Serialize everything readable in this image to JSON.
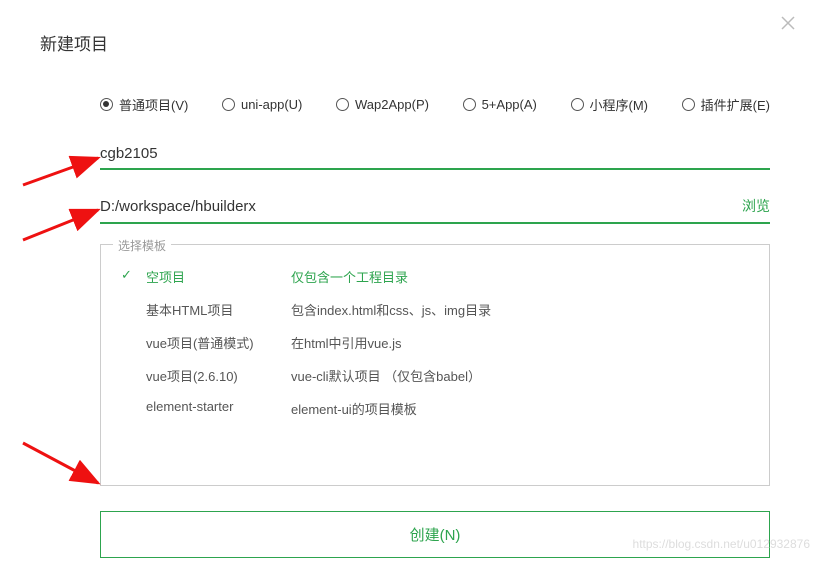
{
  "dialog": {
    "title": "新建项目"
  },
  "radios": [
    {
      "label": "普通项目(V)",
      "selected": true
    },
    {
      "label": "uni-app(U)",
      "selected": false
    },
    {
      "label": "Wap2App(P)",
      "selected": false
    },
    {
      "label": "5+App(A)",
      "selected": false
    },
    {
      "label": "小程序(M)",
      "selected": false
    },
    {
      "label": "插件扩展(E)",
      "selected": false
    }
  ],
  "project_name": {
    "value": "cgb2105"
  },
  "location": {
    "value": "D:/workspace/hbuilderx",
    "browse_label": "浏览"
  },
  "template": {
    "legend": "选择模板",
    "items": [
      {
        "name": "空项目",
        "desc": "仅包含一个工程目录",
        "selected": true
      },
      {
        "name": "基本HTML项目",
        "desc": "包含index.html和css、js、img目录",
        "selected": false
      },
      {
        "name": "vue项目(普通模式)",
        "desc": "在html中引用vue.js",
        "selected": false
      },
      {
        "name": "vue项目(2.6.10)",
        "desc": "vue-cli默认项目 （仅包含babel）",
        "selected": false
      },
      {
        "name": "element-starter",
        "desc": "element-ui的项目模板",
        "selected": false
      }
    ]
  },
  "create_button": "创建(N)",
  "watermark": "https://blog.csdn.net/u012932876"
}
